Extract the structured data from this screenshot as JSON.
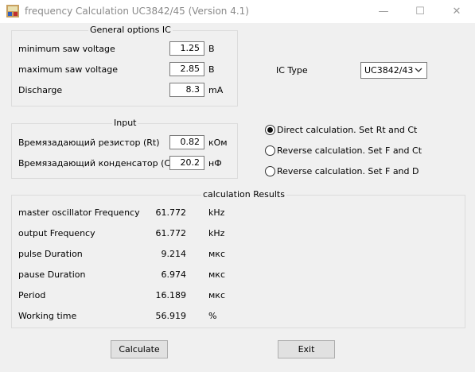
{
  "window": {
    "title": "frequency Calculation UC3842/45 (Version 4.1)"
  },
  "controls": {
    "minimize": "—",
    "maximize": "☐",
    "close": "✕"
  },
  "general": {
    "title": "General options IC",
    "rows": [
      {
        "label": "minimum saw voltage",
        "value": "1.25",
        "unit": "В"
      },
      {
        "label": "maximum saw voltage",
        "value": "2.85",
        "unit": "В"
      },
      {
        "label": "Discharge",
        "value": "8.3",
        "unit": "mA"
      }
    ]
  },
  "ic": {
    "label": "IC Type",
    "selected": "UC3842/43"
  },
  "input": {
    "title": "Input",
    "rows": [
      {
        "label": "Времязадающий резистор (Rt)",
        "value": "0.82",
        "unit": "кОм"
      },
      {
        "label": "Времязадающий конденсатор (Ct)",
        "value": "20.2",
        "unit": "нФ"
      }
    ]
  },
  "modes": [
    {
      "label": "Direct calculation. Set Rt and Ct",
      "selected": true
    },
    {
      "label": "Reverse calculation. Set F and Ct",
      "selected": false
    },
    {
      "label": "Reverse calculation. Set F and D",
      "selected": false
    }
  ],
  "results": {
    "title": "calculation Results",
    "rows": [
      {
        "label": "master oscillator Frequency",
        "value": "61.772",
        "unit": "kHz"
      },
      {
        "label": "output Frequency",
        "value": "61.772",
        "unit": "kHz"
      },
      {
        "label": "pulse Duration",
        "value": "9.214",
        "unit": "мкс"
      },
      {
        "label": "pause Duration",
        "value": "6.974",
        "unit": "мкс"
      },
      {
        "label": "Period",
        "value": "16.189",
        "unit": "мкс"
      },
      {
        "label": "Working time",
        "value": "56.919",
        "unit": "%"
      }
    ]
  },
  "buttons": {
    "calculate": "Calculate",
    "exit": "Exit"
  }
}
